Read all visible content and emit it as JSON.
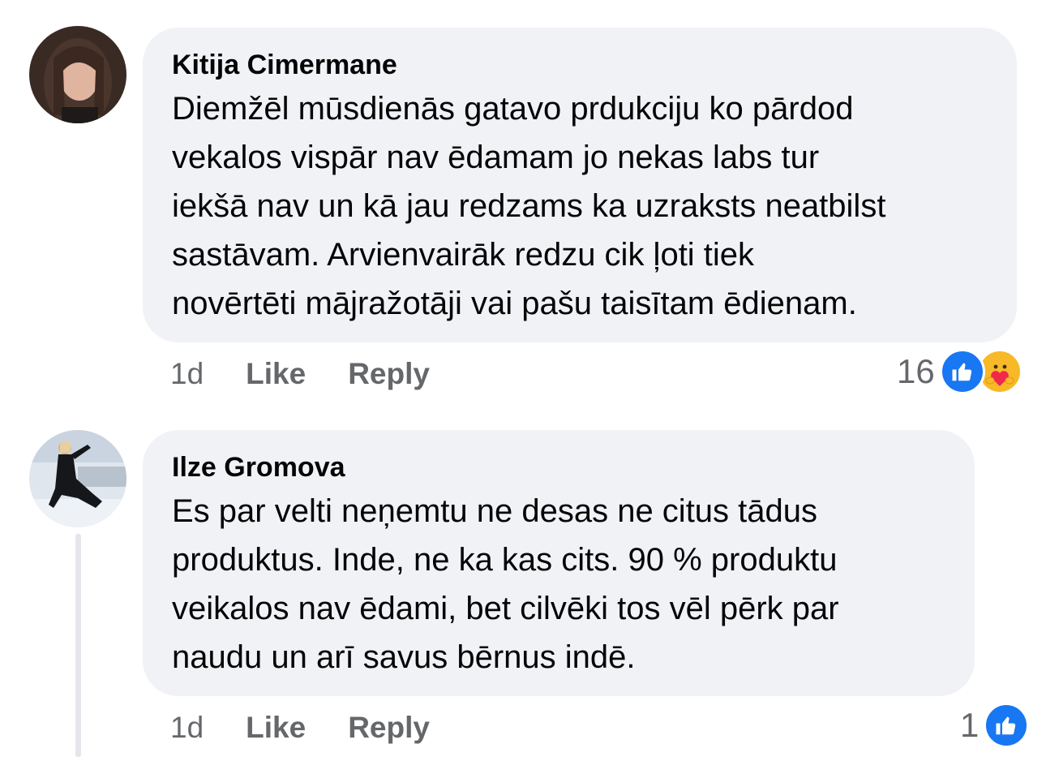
{
  "comments": [
    {
      "author": "Kitija Cimermane",
      "text": "Diemžēl mūsdienās gatavo prdukciju ko pārdod\nvekalos vispār nav ēdamam jo nekas labs tur\niekšā nav un kā jau redzams ka uzraksts neatbilst\nsastāvam. Arvienvairāk redzu cik ļoti tiek\nnovērtēti mājražotāji vai pašu taisītam ēdienam.",
      "time": "1d",
      "like_label": "Like",
      "reply_label": "Reply",
      "reaction_count": "16",
      "reactions": [
        "like-icon",
        "care-icon"
      ]
    },
    {
      "author": "Ilze Gromova",
      "text": "Es par velti neņemtu ne desas ne citus tādus\nproduktus. Inde, ne ka kas cits. 90 % produktu\nveikalos nav ēdami, bet cilvēki tos vēl pērk par\nnaudu un arī savus bērnus indē.",
      "time": "1d",
      "like_label": "Like",
      "reply_label": "Reply",
      "reaction_count": "1",
      "reactions": [
        "like-icon"
      ]
    }
  ],
  "colors": {
    "bubble": "#f0f2f5",
    "secondary_text": "#65676b",
    "like_blue": "#1877f2",
    "care_yellow": "#f7b928"
  }
}
